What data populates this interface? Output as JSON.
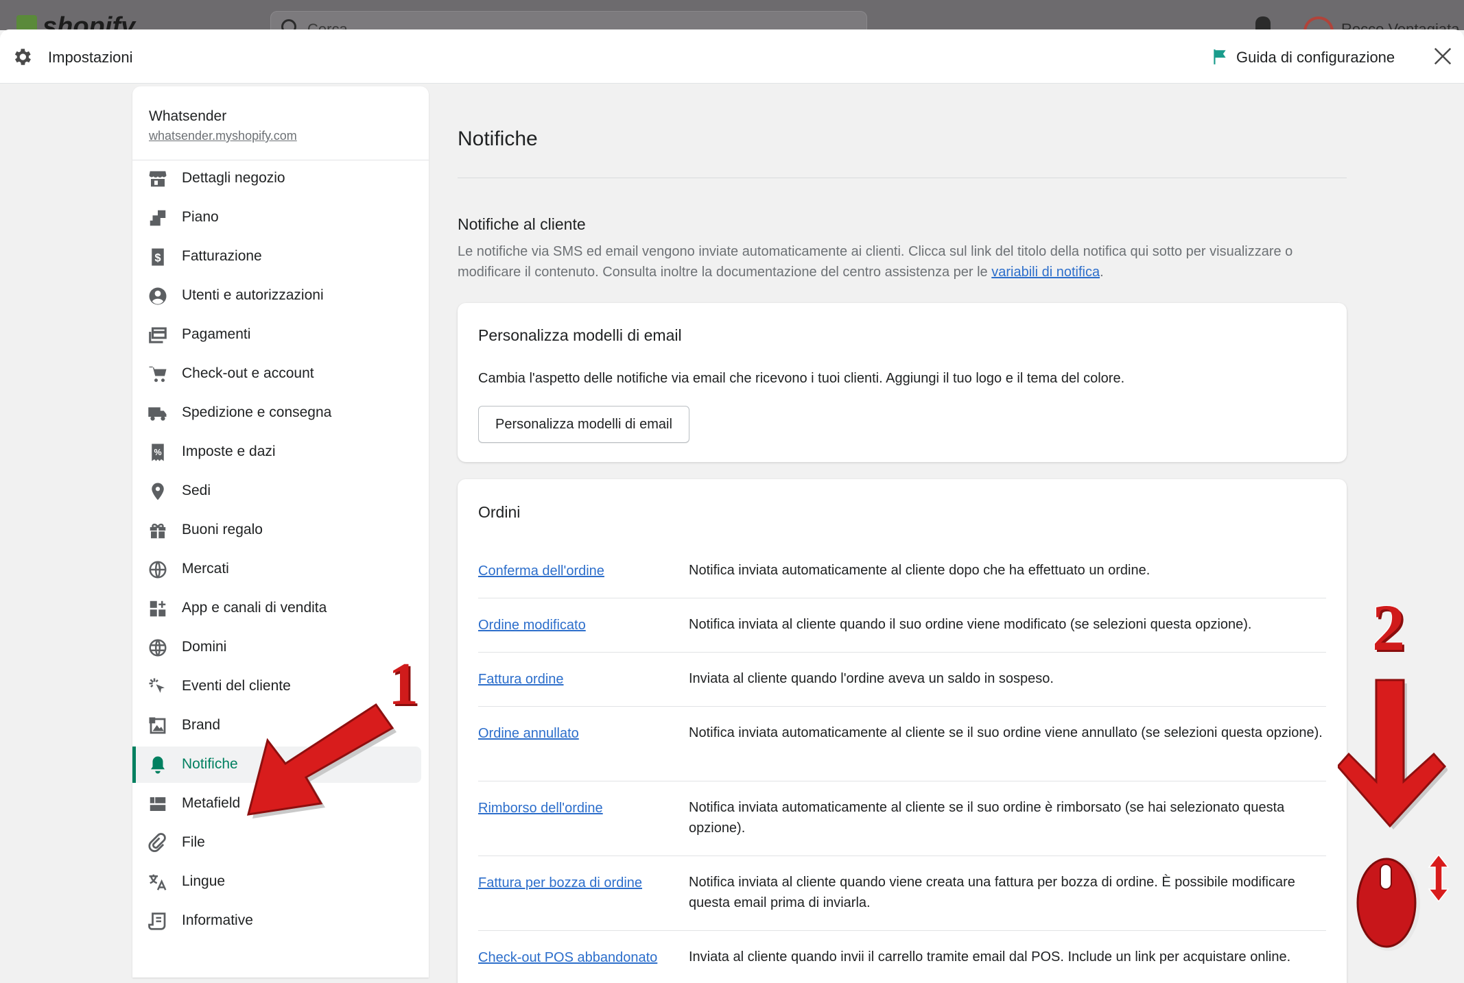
{
  "topbar": {
    "logo_text": "shopify",
    "search_placeholder": "Cerca",
    "user_name": "Rocco Ventagiata"
  },
  "header": {
    "title": "Impostazioni",
    "guide_label": "Guida di configurazione"
  },
  "store": {
    "name": "Whatsender",
    "url": "whatsender.myshopify.com"
  },
  "sidebar": {
    "items": [
      {
        "label": "Dettagli negozio",
        "icon": "store-icon"
      },
      {
        "label": "Piano",
        "icon": "plan-icon"
      },
      {
        "label": "Fatturazione",
        "icon": "billing-icon"
      },
      {
        "label": "Utenti e autorizzazioni",
        "icon": "user-icon"
      },
      {
        "label": "Pagamenti",
        "icon": "payments-icon"
      },
      {
        "label": "Check-out e account",
        "icon": "cart-icon"
      },
      {
        "label": "Spedizione e consegna",
        "icon": "truck-icon"
      },
      {
        "label": "Imposte e dazi",
        "icon": "tax-icon"
      },
      {
        "label": "Sedi",
        "icon": "location-icon"
      },
      {
        "label": "Buoni regalo",
        "icon": "gift-icon"
      },
      {
        "label": "Mercati",
        "icon": "globe-icon"
      },
      {
        "label": "App e canali di vendita",
        "icon": "apps-icon"
      },
      {
        "label": "Domini",
        "icon": "domain-icon"
      },
      {
        "label": "Eventi del cliente",
        "icon": "events-icon"
      },
      {
        "label": "Brand",
        "icon": "brand-icon"
      },
      {
        "label": "Notifiche",
        "icon": "bell-icon",
        "active": true
      },
      {
        "label": "Metafield",
        "icon": "metafield-icon"
      },
      {
        "label": "File",
        "icon": "paperclip-icon"
      },
      {
        "label": "Lingue",
        "icon": "language-icon"
      },
      {
        "label": "Informative",
        "icon": "policy-icon"
      }
    ]
  },
  "main": {
    "page_title": "Notifiche",
    "section_title": "Notifiche al cliente",
    "section_desc": "Le notifiche via SMS ed email vengono inviate automaticamente ai clienti. Clicca sul link del titolo della notifica qui sotto per visualizzare o modificare il contenuto. Consulta inoltre la documentazione del centro assistenza per le ",
    "section_link": "variabili di notifica",
    "section_end": ".",
    "email_card": {
      "title": "Personalizza modelli di email",
      "desc": "Cambia l'aspetto delle notifiche via email che ricevono i tuoi clienti. Aggiungi il tuo logo e il tema del colore.",
      "button": "Personalizza modelli di email"
    },
    "orders": {
      "title": "Ordini",
      "rows": [
        {
          "link": "Conferma dell'ordine",
          "desc": "Notifica inviata automaticamente al cliente dopo che ha effettuato un ordine."
        },
        {
          "link": "Ordine modificato",
          "desc": "Notifica inviata al cliente quando il suo ordine viene modificato (se selezioni questa opzione)."
        },
        {
          "link": "Fattura ordine",
          "desc": "Inviata al cliente quando l'ordine aveva un saldo in sospeso."
        },
        {
          "link": "Ordine annullato",
          "desc": "Notifica inviata automaticamente al cliente se il suo ordine viene annullato (se selezioni questa opzione)."
        },
        {
          "link": "Rimborso dell'ordine",
          "desc": "Notifica inviata automaticamente al cliente se il suo ordine è rimborsato (se hai selezionato questa opzione)."
        },
        {
          "link": "Fattura per bozza di ordine",
          "desc": "Notifica inviata al cliente quando viene creata una fattura per bozza di ordine. È possibile modificare questa email prima di inviarla."
        },
        {
          "link": "Check-out POS abbandonato",
          "desc": "Inviata al cliente quando invii il carrello tramite email dal POS. Include un link per acquistare online."
        }
      ]
    }
  },
  "annotations": {
    "step1": "1",
    "step2": "2"
  },
  "colors": {
    "accent_green": "#008060",
    "link_blue": "#2c6ecb",
    "annotation_red": "#d01b1b"
  }
}
